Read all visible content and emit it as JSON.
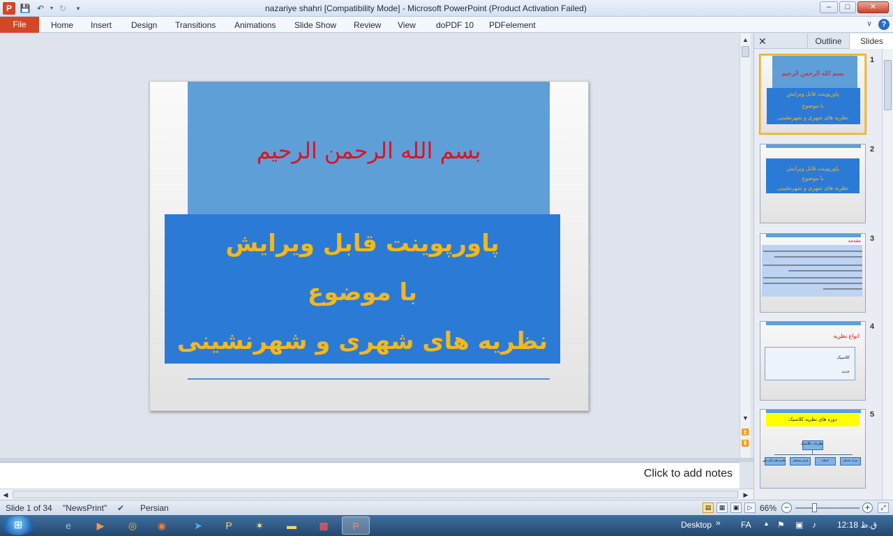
{
  "window": {
    "title": "nazariye shahri [Compatibility Mode]  -  Microsoft PowerPoint (Product Activation Failed)",
    "app_icon": "P"
  },
  "ribbon": {
    "file_label": "File",
    "tabs": [
      "Home",
      "Insert",
      "Design",
      "Transitions",
      "Animations",
      "Slide Show",
      "Review",
      "View",
      "doPDF 10",
      "PDFelement"
    ]
  },
  "slide": {
    "basmala": "بسم الله الرحمن الرحیم",
    "line1": "پاورپوینت قابل ویرایش",
    "line2": "با موضوع",
    "line3": "نظریه های شهری و شهرنشینی"
  },
  "notes": {
    "placeholder": "Click to add notes"
  },
  "pane": {
    "tabs": [
      "Outline",
      "Slides"
    ],
    "thumbnails": [
      {
        "num": "1",
        "title": "بسم الله الرحمن الرحیم",
        "lines": [
          "پاورپوینت قابل ویرایش",
          "با موضوع",
          "نظریه های شهری و شهرنشینی"
        ]
      },
      {
        "num": "2",
        "lines": [
          "پاورپوینت قابل ویرایش",
          "با موضوع",
          "نظریه های شهری و شهرنشینی"
        ]
      },
      {
        "num": "3",
        "title": "مقدمه"
      },
      {
        "num": "4",
        "title": "انواع نظریه",
        "items": [
          "کلاسیک",
          "جدید"
        ]
      },
      {
        "num": "5",
        "title": "دوره های نظریه کلاسیک",
        "root": "نظریات کلاسیک",
        "children": [
          "دوران باستان",
          "اسلام",
          "قرون وسطی",
          "نظریه های آغاز شهر"
        ]
      }
    ]
  },
  "status": {
    "slide_info": "Slide 1 of 34",
    "theme": "\"NewsPrint\"",
    "language": "Persian",
    "zoom": "66%"
  },
  "taskbar": {
    "desktop_label": "Desktop",
    "lang": "FA",
    "clock": "12:18 ق.ظ"
  }
}
